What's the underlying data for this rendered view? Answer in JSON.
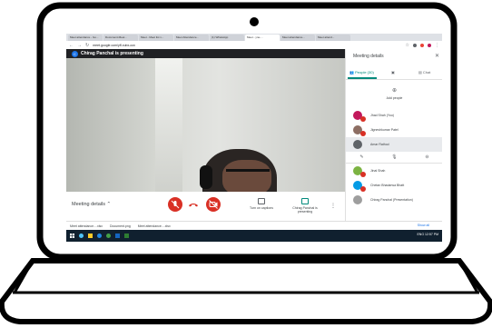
{
  "browser": {
    "tabs": [
      "Meet attendance - Go...",
      "Document-Meet...",
      "Meet - Meet list x...",
      "Meet Attendance...",
      "(1) WhatsApp",
      "Meet - yne-...",
      "Meet attendance...",
      "Meet attend..."
    ],
    "url": "meet.google.com/yff-xubx-oov"
  },
  "meet": {
    "presenter_initial": "C",
    "presenter_text": "Chirag Panchal is presenting",
    "meeting_details_label": "Meeting details",
    "captions_label": "Turn on captions",
    "presenting_label": "Chirag Panchal is presenting"
  },
  "panel": {
    "title": "Meeting details",
    "tab_people": "People (30)",
    "tab_chat": "Chat",
    "add_people": "Add people",
    "participants": [
      {
        "name": "Jhad Shah (You)",
        "color": "#c2185b"
      },
      {
        "name": "Jigneshkumar Patel",
        "color": "#8d6e63"
      },
      {
        "name": "Amar Rathod",
        "color": "#5f6368"
      },
      {
        "name": "Jinal Shah",
        "color": "#7cb342"
      },
      {
        "name": "Chetan Bhadarwa Bhatt",
        "color": "#039be5"
      },
      {
        "name": "Chirag Panchal (Presentation)",
        "color": "#9e9e9e"
      }
    ]
  },
  "downloads": {
    "items": [
      "Meet attendance....xlsx",
      "Document.png",
      "Meet attendance....xlsx"
    ],
    "show_all": "Show all"
  },
  "taskbar": {
    "clock": "ENG 12:57 PM"
  },
  "colors": {
    "end_call": "#d93025",
    "accent": "#00897b"
  }
}
